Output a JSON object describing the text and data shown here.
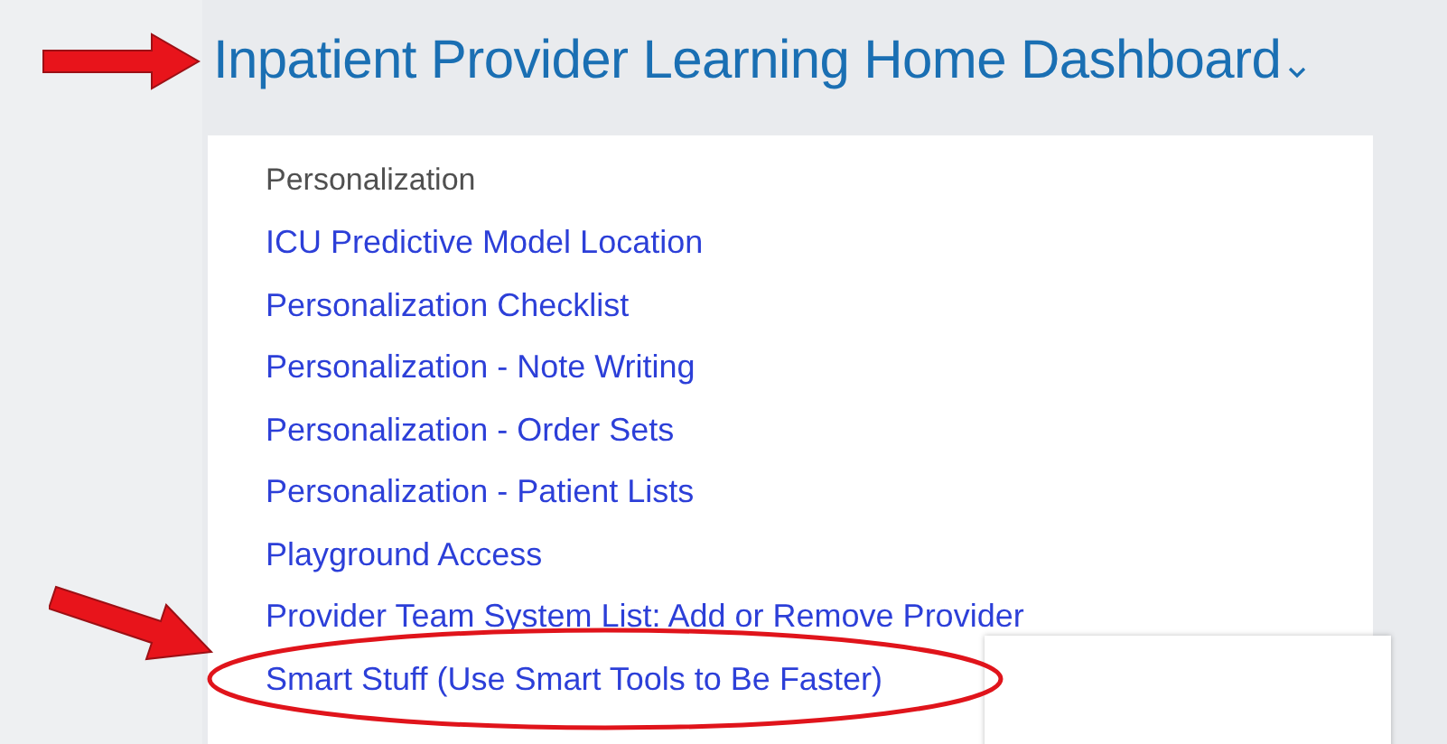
{
  "header": {
    "title": "Inpatient Provider Learning Home Dashboard",
    "pointed": true
  },
  "menu": {
    "items": [
      {
        "kind": "header",
        "label": "Personalization",
        "circled": false
      },
      {
        "kind": "link",
        "label": "ICU Predictive Model Location",
        "circled": false
      },
      {
        "kind": "link",
        "label": "Personalization Checklist",
        "circled": false
      },
      {
        "kind": "link",
        "label": "Personalization - Note Writing",
        "circled": false
      },
      {
        "kind": "link",
        "label": "Personalization - Order Sets",
        "circled": false
      },
      {
        "kind": "link",
        "label": "Personalization - Patient Lists",
        "circled": false
      },
      {
        "kind": "link",
        "label": "Playground Access",
        "circled": false
      },
      {
        "kind": "link",
        "label": "Provider Team System List: Add or Remove Provider",
        "circled": false
      },
      {
        "kind": "link",
        "label": "Smart Stuff (Use Smart Tools to Be Faster)",
        "circled": true
      }
    ]
  }
}
